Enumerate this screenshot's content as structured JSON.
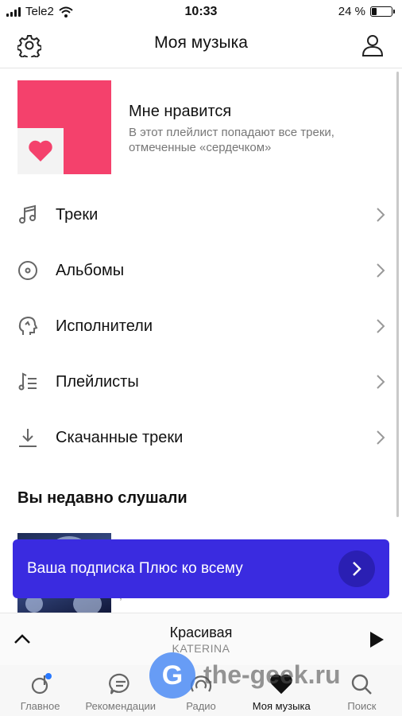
{
  "status": {
    "carrier": "Tele2",
    "time": "10:33",
    "battery": "24 %",
    "battery_level": 0.24
  },
  "header": {
    "title": "Моя музыка",
    "settings_icon": "gear-icon",
    "profile_icon": "user-icon"
  },
  "liked": {
    "title": "Мне нравится",
    "description": "В этот плейлист попадают все треки, отмеченные «сердечком»",
    "cover_color": "#f4416c"
  },
  "menu": [
    {
      "label": "Треки",
      "icon": "music-note-icon"
    },
    {
      "label": "Альбомы",
      "icon": "disc-icon"
    },
    {
      "label": "Исполнители",
      "icon": "artist-icon"
    },
    {
      "label": "Плейлисты",
      "icon": "playlist-icon"
    },
    {
      "label": "Скачанные треки",
      "icon": "download-icon"
    }
  ],
  "recent": {
    "title": "Вы недавно слушали"
  },
  "promo": {
    "label": "Ваша подписка Плюс ко всему",
    "color": "#3a2be0"
  },
  "player": {
    "title": "Красивая",
    "artist": "KATERINA"
  },
  "tabs": [
    {
      "label": "Главное",
      "icon": "home-icon"
    },
    {
      "label": "Рекомендации",
      "icon": "chat-icon"
    },
    {
      "label": "Радио",
      "icon": "radio-icon"
    },
    {
      "label": "Моя музыка",
      "icon": "heart-icon"
    },
    {
      "label": "Поиск",
      "icon": "search-icon"
    }
  ],
  "watermark": {
    "letter": "G",
    "text": "the-geek.ru"
  }
}
